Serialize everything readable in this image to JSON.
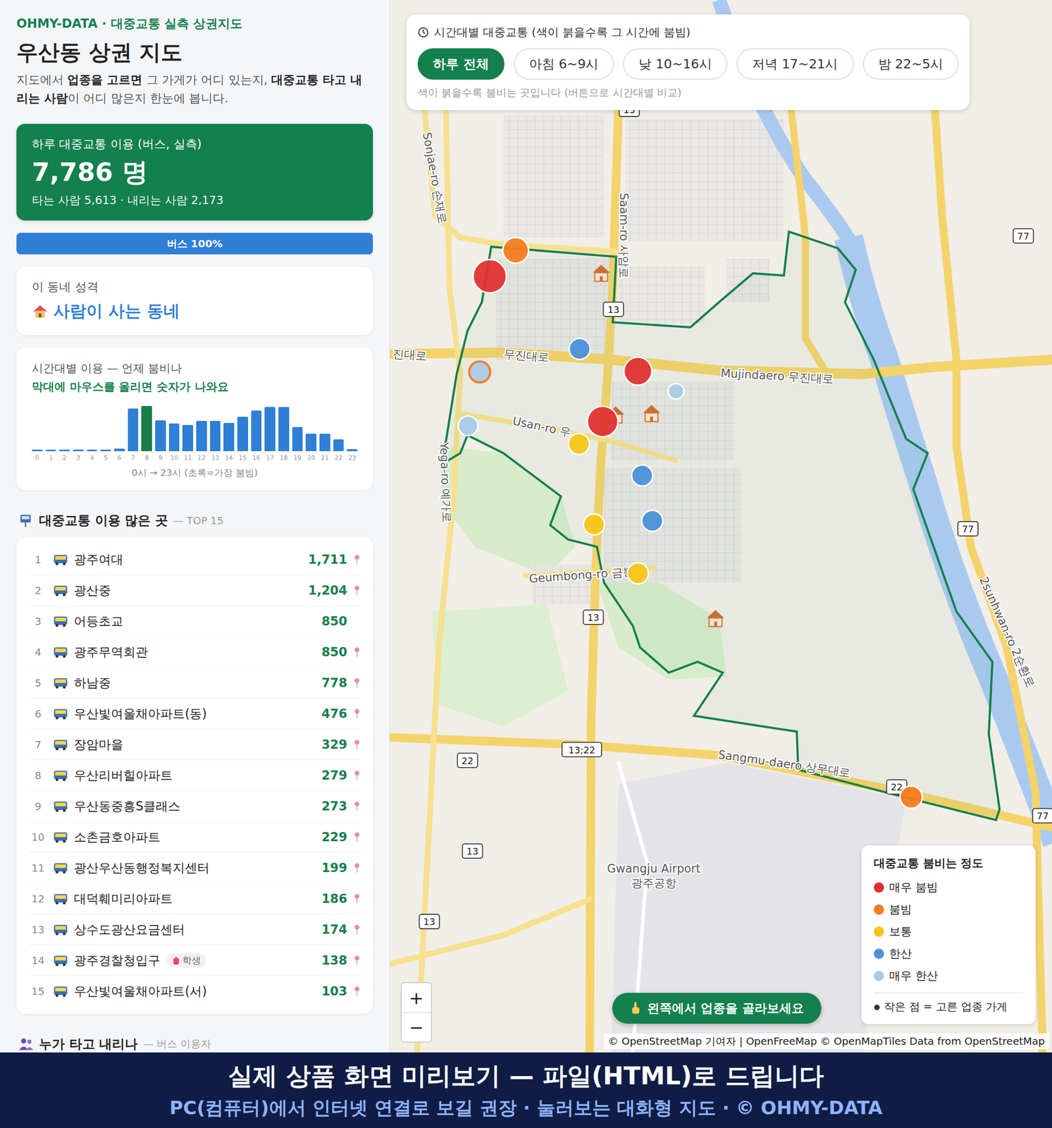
{
  "brand": "OHMY-DATA · 대중교통 실측 상권지도",
  "title": "우산동 상권 지도",
  "description": [
    {
      "text": "지도에서 ",
      "bold": false
    },
    {
      "text": "업종을 고르면",
      "bold": true
    },
    {
      "text": " 그 가게가 어디 있는지, ",
      "bold": false
    },
    {
      "text": "대중교통 타고 내리는 사람",
      "bold": true
    },
    {
      "text": "이 어디 많은지 한눈에 봅니다.",
      "bold": false
    }
  ],
  "summary": {
    "label": "하루 대중교통 이용 (버스, 실측)",
    "value": "7,786 명",
    "sub": "타는 사람 5,613 · 내리는 사람 2,173"
  },
  "mode_bar": {
    "label": "버스 100%",
    "level": 1
  },
  "character": {
    "label": "이 동네 성격",
    "value": "사람이 사는 동네"
  },
  "hourly": {
    "title": "시간대별 이용 — 언제 붐비나",
    "hint": "막대에 마우스를 올리면 숫자가 나와요",
    "values": [
      20,
      20,
      20,
      20,
      20,
      22,
      42,
      656,
      690,
      476,
      423,
      402,
      466,
      466,
      434,
      529,
      624,
      680,
      675,
      370,
      265,
      265,
      180,
      32
    ],
    "labels": [
      "0",
      "1",
      "2",
      "3",
      "4",
      "5",
      "6",
      "7",
      "8",
      "9",
      "10",
      "11",
      "12",
      "13",
      "14",
      "15",
      "16",
      "17",
      "18",
      "19",
      "20",
      "21",
      "22",
      "23"
    ],
    "caption": "0시 → 23시 (초록=가장 붐빔)"
  },
  "top_list": {
    "title": "대중교통 이용 많은 곳",
    "sub": "— TOP 15",
    "rows": [
      {
        "rank": "1",
        "name": "광주여대",
        "count": "1,711",
        "pin": true,
        "badge": ""
      },
      {
        "rank": "2",
        "name": "광산중",
        "count": "1,204",
        "pin": true,
        "badge": ""
      },
      {
        "rank": "3",
        "name": "어등초교",
        "count": "850",
        "pin": false,
        "badge": ""
      },
      {
        "rank": "4",
        "name": "광주무역회관",
        "count": "850",
        "pin": true,
        "badge": ""
      },
      {
        "rank": "5",
        "name": "하남중",
        "count": "778",
        "pin": true,
        "badge": ""
      },
      {
        "rank": "6",
        "name": "우산빛여울채아파트(동)",
        "count": "476",
        "pin": true,
        "badge": ""
      },
      {
        "rank": "7",
        "name": "장암마을",
        "count": "329",
        "pin": true,
        "badge": ""
      },
      {
        "rank": "8",
        "name": "우산리버힐아파트",
        "count": "279",
        "pin": true,
        "badge": ""
      },
      {
        "rank": "9",
        "name": "우산동중흥S클래스",
        "count": "273",
        "pin": true,
        "badge": ""
      },
      {
        "rank": "10",
        "name": "소촌금호아파트",
        "count": "229",
        "pin": true,
        "badge": ""
      },
      {
        "rank": "11",
        "name": "광산우산동행정복지센터",
        "count": "199",
        "pin": true,
        "badge": ""
      },
      {
        "rank": "12",
        "name": "대덕훼미리아파트",
        "count": "186",
        "pin": true,
        "badge": ""
      },
      {
        "rank": "13",
        "name": "상수도광산요금센터",
        "count": "174",
        "pin": true,
        "badge": ""
      },
      {
        "rank": "14",
        "name": "광주경찰청입구",
        "count": "138",
        "pin": true,
        "badge": "학생"
      },
      {
        "rank": "15",
        "name": "우산빛여울채아파트(서)",
        "count": "103",
        "pin": true,
        "badge": ""
      }
    ]
  },
  "riders": {
    "title": "누가 타고 내리나",
    "sub": "— 버스 이용자"
  },
  "time_panel": {
    "title": "시간대별 대중교통 (색이 붉을수록 그 시간에 붐빔)",
    "buttons": [
      {
        "label": "하루 전체",
        "selected": true
      },
      {
        "label": "아침 6~9시",
        "selected": false
      },
      {
        "label": "낮 10~16시",
        "selected": false
      },
      {
        "label": "저녁 17~21시",
        "selected": false
      },
      {
        "label": "밤 22~5시",
        "selected": false
      }
    ],
    "hint": "색이 붉을수록 붐비는 곳입니다 (버튼으로 시간대별 비교)"
  },
  "road_labels": [
    "Sonjae-ro 손재로",
    "Saam-ro 사암로",
    "진대로",
    "무진대로",
    "Mujindaero 무진대로",
    "Usan-ro 우",
    "Yega-ro 예가로",
    "Geumbong-ro 금봉",
    "Sangmu-daero 상무대로",
    "2sunhwan-ro 2순환로",
    "Gwangju Airport",
    "광주공항"
  ],
  "shields": [
    "13",
    "13",
    "13",
    "13",
    "13",
    "77",
    "77",
    "77",
    "22",
    "22",
    "13;22"
  ],
  "stops": [
    {
      "color": "#f57c1f",
      "level": 0.58,
      "outlined": false
    },
    {
      "color": "#e03131",
      "level": 0.89,
      "outlined": false
    },
    {
      "color": "#4a90d9",
      "level": 0.39,
      "outlined": false
    },
    {
      "color": "#e03131",
      "level": 0.67,
      "outlined": false
    },
    {
      "color": "#a8cce6",
      "level": 0.39,
      "outlined": true
    },
    {
      "color": "#a8cce6",
      "level": 0.17,
      "outlined": false
    },
    {
      "color": "#e03131",
      "level": 0.78,
      "outlined": false
    },
    {
      "color": "#a8cce6",
      "level": 0.33,
      "outlined": false
    },
    {
      "color": "#f5c518",
      "level": 0.39,
      "outlined": false
    },
    {
      "color": "#4a90d9",
      "level": 0.39,
      "outlined": false
    },
    {
      "color": "#4a90d9",
      "level": 0.39,
      "outlined": false
    },
    {
      "color": "#f5c518",
      "level": 0.39,
      "outlined": false
    },
    {
      "color": "#f5c518",
      "level": 0.39,
      "outlined": false
    },
    {
      "color": "#f57c1f",
      "level": 0.44,
      "outlined": false
    }
  ],
  "legend": {
    "title": "대중교통 붐비는 정도",
    "items": [
      {
        "label": "매우 붐빔",
        "color": "#e03131"
      },
      {
        "label": "붐빔",
        "color": "#f57c1f"
      },
      {
        "label": "보통",
        "color": "#f5c518"
      },
      {
        "label": "한산",
        "color": "#4a90d9"
      },
      {
        "label": "매우 한산",
        "color": "#a8cce6"
      }
    ],
    "dot": "●",
    "note": "작은 점 = 고른 업종 가게"
  },
  "zoom": [
    "+",
    "−"
  ],
  "pick_hint": "왼쪽에서 업종을 골라보세요",
  "attribution": "© OpenStreetMap 기여자 | OpenFreeMap © OpenMapTiles Data from OpenStreetMap",
  "banner": {
    "line1": "실제 상품 화면 미리보기 — 파일(HTML)로 드립니다",
    "line2": "PC(컴퓨터)에서 인터넷 연결로 보길 권장 · 눌러보는 대화형 지도 · © OHMY-DATA"
  }
}
